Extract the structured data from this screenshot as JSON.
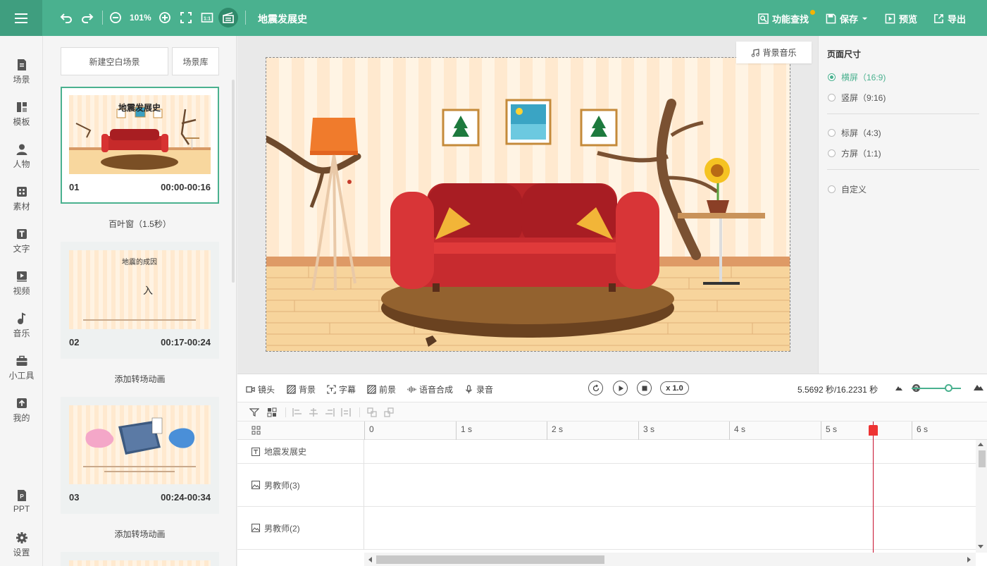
{
  "topbar": {
    "zoom": "101%",
    "doc_title": "地震发展史",
    "find_label": "功能查找",
    "save_label": "保存",
    "preview_label": "预览",
    "export_label": "导出"
  },
  "nav": [
    {
      "label": "场景",
      "icon": "scene-icon"
    },
    {
      "label": "模板",
      "icon": "template-icon"
    },
    {
      "label": "人物",
      "icon": "person-icon"
    },
    {
      "label": "素材",
      "icon": "material-icon"
    },
    {
      "label": "文字",
      "icon": "text-icon"
    },
    {
      "label": "视频",
      "icon": "video-icon"
    },
    {
      "label": "音乐",
      "icon": "music-icon"
    },
    {
      "label": "小工具",
      "icon": "toolbox-icon"
    },
    {
      "label": "我的",
      "icon": "upload-icon"
    },
    {
      "label": "PPT",
      "icon": "ppt-icon"
    },
    {
      "label": "设置",
      "icon": "gear-icon"
    }
  ],
  "scenes_panel": {
    "new_blank": "新建空白场景",
    "library": "场景库",
    "scenes": [
      {
        "num": "01",
        "time": "00:00-00:16",
        "transition": "百叶窗（1.5秒）",
        "thumb_title": "地震发展史"
      },
      {
        "num": "02",
        "time": "00:17-00:24",
        "transition": "添加转场动画",
        "thumb_title": "地震的成因",
        "thumb_char": "入"
      },
      {
        "num": "03",
        "time": "00:24-00:34",
        "transition": "添加转场动画"
      }
    ]
  },
  "stage": {
    "bg_music": "背景音乐"
  },
  "page_size": {
    "title": "页面尺寸",
    "options": [
      {
        "label": "横屏（16:9)",
        "selected": true
      },
      {
        "label": "竖屏（9:16)",
        "selected": false
      },
      {
        "label": "标屏（4:3)",
        "selected": false
      },
      {
        "label": "方屏（1:1)",
        "selected": false
      },
      {
        "label": "自定义",
        "selected": false
      }
    ]
  },
  "timeline": {
    "tools": [
      {
        "label": "镜头",
        "icon": "camera-icon"
      },
      {
        "label": "背景",
        "icon": "background-icon"
      },
      {
        "label": "字幕",
        "icon": "subtitle-icon"
      },
      {
        "label": "前景",
        "icon": "foreground-icon"
      },
      {
        "label": "语音合成",
        "icon": "voice-synthesis-icon"
      },
      {
        "label": "录音",
        "icon": "microphone-icon"
      }
    ],
    "speed": "x 1.0",
    "time_readout": "5.5692 秒/16.2231 秒",
    "ticks": [
      "0",
      "1 s",
      "2 s",
      "3 s",
      "4 s",
      "5 s",
      "6 s"
    ],
    "playhead_seconds": 5.5692,
    "total_seconds": 16.2231,
    "tracks": [
      {
        "label": "地震发展史",
        "icon": "text-track-icon"
      },
      {
        "label": "男教师(3)",
        "icon": "image-track-icon"
      },
      {
        "label": "男教师(2)",
        "icon": "image-track-icon"
      }
    ]
  }
}
